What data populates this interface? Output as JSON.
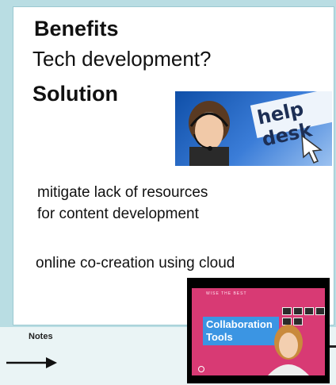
{
  "slide": {
    "heading_benefits": "Benefits",
    "question": "Tech development?",
    "heading_solution": "Solution",
    "point_1": "mitigate lack of resources",
    "point_1_cont": "for content development",
    "point_2": "online co-creation using cloud"
  },
  "helpdesk_image": {
    "text": "help desk"
  },
  "video": {
    "caption_top": "WISE THE BEST",
    "title_line_1": "Collaboration",
    "title_line_2": "Tools"
  },
  "notes": {
    "label": "Notes"
  },
  "colors": {
    "background": "#b9dde3",
    "video_pink": "#d83a74",
    "video_blue": "#3b95e3"
  }
}
